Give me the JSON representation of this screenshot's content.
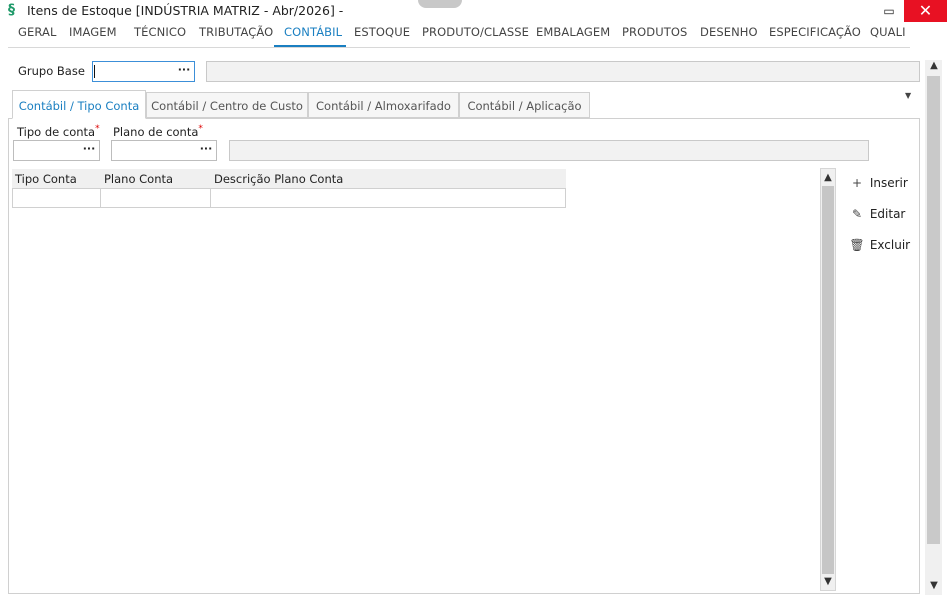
{
  "window": {
    "title": "Itens de Estoque [INDÚSTRIA MATRIZ - Abr/2026]  -",
    "minimize_glyph": "▭",
    "close_glyph": "✕",
    "app_icon": "app-logo-icon"
  },
  "main_tabs": [
    {
      "label": "GERAL"
    },
    {
      "label": "IMAGEM"
    },
    {
      "label": "TÉCNICO"
    },
    {
      "label": "TRIBUTAÇÃO"
    },
    {
      "label": "CONTÁBIL"
    },
    {
      "label": "ESTOQUE"
    },
    {
      "label": "PRODUTO/CLASSE"
    },
    {
      "label": "EMBALAGEM"
    },
    {
      "label": "PRODUTOS"
    },
    {
      "label": "DESENHO"
    },
    {
      "label": "ESPECIFICAÇÃO"
    },
    {
      "label": "QUALI"
    }
  ],
  "active_main_tab": "CONTÁBIL",
  "grupo_base": {
    "label": "Grupo Base",
    "value": "",
    "lookup_glyph": "···"
  },
  "sub_tabs": [
    {
      "label": "Contábil / Tipo Conta"
    },
    {
      "label": "Contábil / Centro de Custo"
    },
    {
      "label": "Contábil / Almoxarifado"
    },
    {
      "label": "Contábil / Aplicação"
    }
  ],
  "active_sub_tab": "Contábil / Tipo Conta",
  "form": {
    "tipo_conta_label": "Tipo de conta",
    "plano_conta_label": "Plano de conta",
    "required_mark": "*",
    "lookup_glyph": "···"
  },
  "grid": {
    "columns": [
      "Tipo Conta",
      "Plano Conta",
      "Descrição Plano Conta"
    ],
    "rows": []
  },
  "actions": {
    "insert": "Inserir",
    "edit": "Editar",
    "delete": "Excluir"
  },
  "colors": {
    "accent": "#1a7fc1",
    "close": "#e81123",
    "required": "#dd0000"
  }
}
